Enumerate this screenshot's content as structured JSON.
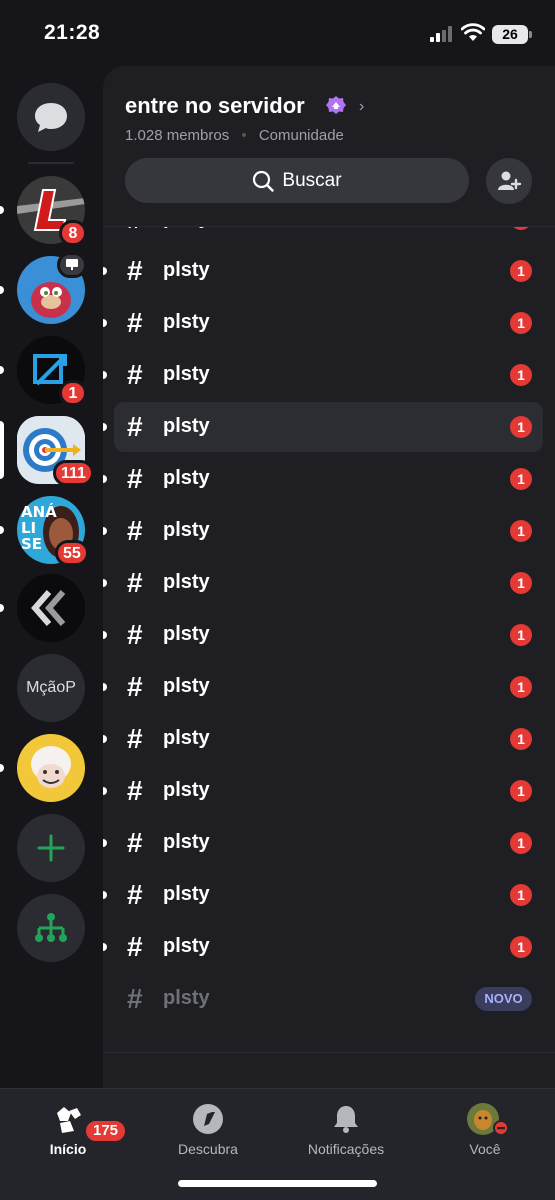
{
  "status": {
    "time": "21:28",
    "battery": "26"
  },
  "rail": {
    "servers": [
      {
        "name": "L",
        "badge": "8",
        "unread": true
      },
      {
        "name": "ugandan-knuckles",
        "badge": "",
        "unread": true
      },
      {
        "name": "x-logo",
        "badge": "1",
        "unread": true
      },
      {
        "name": "target",
        "badge": "111",
        "selected": true
      },
      {
        "name": "analise",
        "label": "ANÁ LI SE",
        "badge": "55",
        "unread": true
      },
      {
        "name": "chevrons",
        "badge": "",
        "unread": true
      },
      {
        "name": "McaoP",
        "label": "MçãoP",
        "badge": ""
      },
      {
        "name": "cartoon",
        "badge": "",
        "unread": true
      }
    ]
  },
  "header": {
    "server_name": "entre no servidor",
    "members": "1.028 membros",
    "separator": "•",
    "community": "Comunidade",
    "search_label": "Buscar"
  },
  "channels": {
    "items": [
      {
        "name": "plsty",
        "unread": "1"
      },
      {
        "name": "plsty",
        "unread": "1"
      },
      {
        "name": "plsty",
        "unread": "1"
      },
      {
        "name": "plsty",
        "unread": "1"
      },
      {
        "name": "plsty",
        "unread": "1"
      },
      {
        "name": "plsty",
        "unread": "1"
      },
      {
        "name": "plsty",
        "unread": "1"
      },
      {
        "name": "plsty",
        "unread": "1"
      },
      {
        "name": "plsty",
        "unread": "1"
      },
      {
        "name": "plsty",
        "unread": "1"
      },
      {
        "name": "plsty",
        "unread": "1"
      },
      {
        "name": "plsty",
        "unread": "1"
      },
      {
        "name": "plsty",
        "unread": "1"
      },
      {
        "name": "plsty",
        "unread": "1"
      },
      {
        "name": "plsty",
        "unread": "1"
      },
      {
        "name": "plsty",
        "unread": "",
        "tag": "NOVO"
      }
    ]
  },
  "nav": {
    "home": "Início",
    "home_badge": "175",
    "discover": "Descubra",
    "notifications": "Notificações",
    "you": "Você"
  },
  "colors": {
    "accent": "#23a559",
    "badge": "#e53935",
    "panel": "#1f1f23"
  }
}
